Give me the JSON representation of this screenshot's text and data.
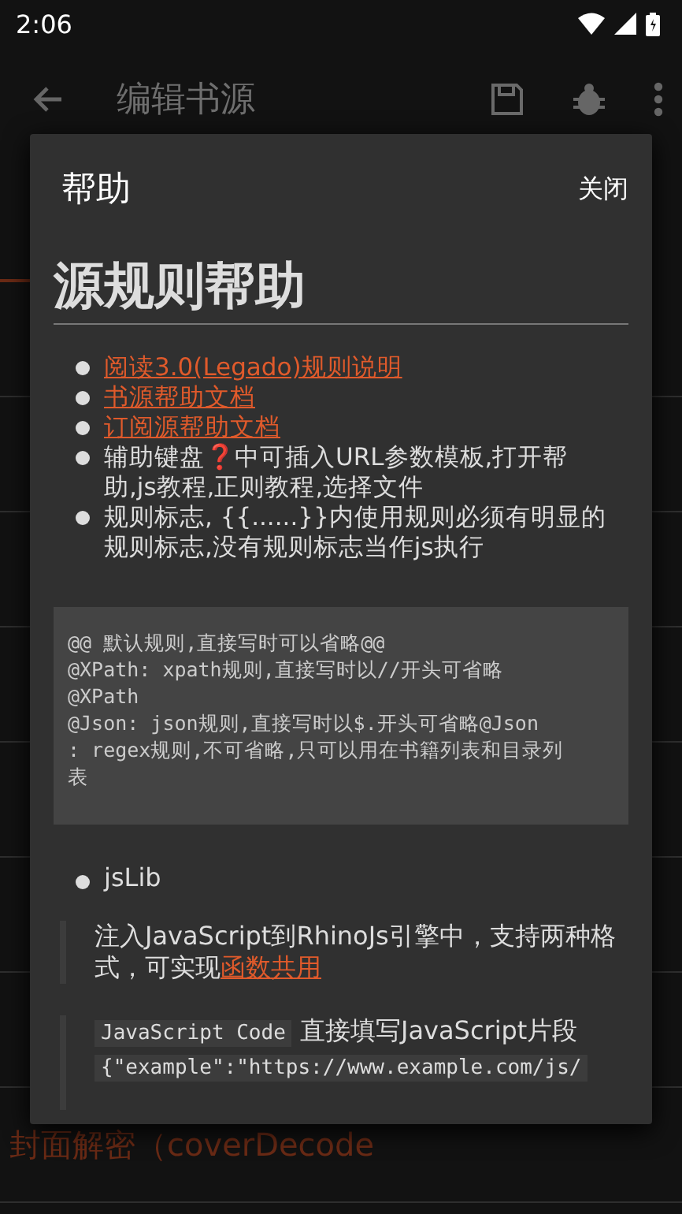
{
  "status_bar": {
    "time": "2:06"
  },
  "app_bar": {
    "title": "编辑书源"
  },
  "background": {
    "row": "封面解密（coverDecode"
  },
  "dialog": {
    "title": "帮助",
    "close": "关闭",
    "heading": "源规则帮助",
    "bullets": [
      {
        "kind": "link",
        "parts": [
          "阅读3.0(Legado)规则说明"
        ]
      },
      {
        "kind": "link",
        "parts": [
          "书源帮助文档"
        ]
      },
      {
        "kind": "link",
        "parts": [
          "订阅源帮助文档"
        ]
      },
      {
        "kind": "text",
        "parts": [
          "辅助键盘",
          "❓",
          "中可插入URL参数模板,打开帮助,js教程,正则教程,选择文件"
        ]
      },
      {
        "kind": "text",
        "parts": [
          "规则标志, {{......}}内使用规则必须有明显的规则标志,没有规则标志当作js执行"
        ]
      }
    ],
    "code_lines": [
      "@@ 默认规则,直接写时可以省略@@",
      "@XPath: xpath规则,直接写时以//开头可省略",
      "@XPath",
      "@Json: json规则,直接写时以$.开头可省略@Json",
      ": regex规则,不可省略,只可以用在书籍列表和目录列",
      "表"
    ],
    "section": "jsLib",
    "quote": {
      "text": "注入JavaScript到RhinoJs引擎中，支持两种格式，可实现",
      "link": "函数共用"
    },
    "quote2": {
      "code": "JavaScript Code",
      "text": "直接填写JavaScript片段",
      "code_line": "{\"example\":\"https://www.example.com/js/"
    }
  }
}
